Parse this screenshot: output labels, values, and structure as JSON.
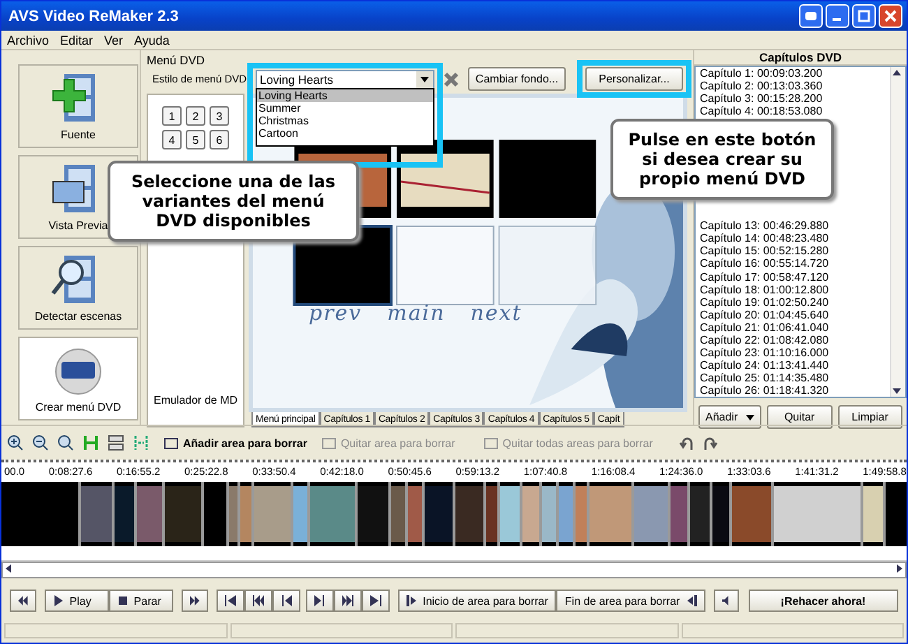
{
  "window": {
    "title": "AVS Video ReMaker 2.3"
  },
  "menu": [
    "Archivo",
    "Editar",
    "Ver",
    "Ayuda"
  ],
  "sidebar": [
    {
      "label": "Fuente",
      "kind": "add",
      "selected": false
    },
    {
      "label": "Vista Previa",
      "kind": "preview",
      "selected": false
    },
    {
      "label": "Detectar escenas",
      "kind": "detect",
      "selected": false
    },
    {
      "label": "Crear menú DVD",
      "kind": "dvd",
      "selected": true
    }
  ],
  "dvd_menu": {
    "group_title": "Menú DVD",
    "style_label": "Estilo de menú DVD:",
    "style_value": "Loving Hearts",
    "style_options": [
      {
        "label": "Loving Hearts",
        "selected": true
      },
      {
        "label": "Summer",
        "selected": false
      },
      {
        "label": "Christmas",
        "selected": false
      },
      {
        "label": "Cartoon",
        "selected": false
      }
    ],
    "buttons": [
      "Cambiar fondo...",
      "Personalizar..."
    ],
    "page_buttons": [
      "1",
      "2",
      "3",
      "4",
      "5",
      "6"
    ],
    "emulator_label": "Emulador de MD",
    "preview_links": [
      "prev",
      "main",
      "next"
    ],
    "tabs": [
      {
        "label": "Menú principal",
        "selected": true
      },
      {
        "label": "Capítulos 1",
        "selected": false
      },
      {
        "label": "Capítulos 2",
        "selected": false
      },
      {
        "label": "Capítulos 3",
        "selected": false
      },
      {
        "label": "Capítulos 4",
        "selected": false
      },
      {
        "label": "Capítulos 5",
        "selected": false
      },
      {
        "label": "Capít",
        "selected": false
      }
    ]
  },
  "chapters": {
    "title": "Capítulos DVD",
    "items": [
      {
        "label": "Capítulo 1:",
        "time": "00:09:03.200"
      },
      {
        "label": "Capítulo 2:",
        "time": "00:13:03.360"
      },
      {
        "label": "Capítulo 3:",
        "time": "00:15:28.200"
      },
      {
        "label": "Capítulo 4:",
        "time": "00:18:53.080"
      },
      {
        "label": "Capítulo 13:",
        "time": "00:46:29.880"
      },
      {
        "label": "Capítulo 14:",
        "time": "00:48:23.480"
      },
      {
        "label": "Capítulo 15:",
        "time": "00:52:15.280"
      },
      {
        "label": "Capítulo 16:",
        "time": "00:55:14.720"
      },
      {
        "label": "Capítulo 17:",
        "time": "00:58:47.120"
      },
      {
        "label": "Capítulo 18:",
        "time": "01:00:12.800"
      },
      {
        "label": "Capítulo 19:",
        "time": "01:02:50.240"
      },
      {
        "label": "Capítulo 20:",
        "time": "01:04:45.640"
      },
      {
        "label": "Capítulo 21:",
        "time": "01:06:41.040"
      },
      {
        "label": "Capítulo 22:",
        "time": "01:08:42.080"
      },
      {
        "label": "Capítulo 23:",
        "time": "01:10:16.000"
      },
      {
        "label": "Capítulo 24:",
        "time": "01:13:41.440"
      },
      {
        "label": "Capítulo 25:",
        "time": "01:14:35.480"
      },
      {
        "label": "Capítulo 26:",
        "time": "01:18:41.320"
      }
    ],
    "buttons": [
      "Añadir",
      "Quitar",
      "Limpiar"
    ]
  },
  "toolbar": [
    {
      "label": "Añadir area para borrar",
      "disabled": false
    },
    {
      "label": "Quitar area para borrar",
      "disabled": true
    },
    {
      "label": "Quitar todas areas para borrar",
      "disabled": true
    }
  ],
  "ruler": [
    "00.0",
    "0:08:27.6",
    "0:16:55.2",
    "0:25:22.8",
    "0:33:50.4",
    "0:42:18.0",
    "0:50:45.6",
    "0:59:13.2",
    "1:07:40.8",
    "1:16:08.4",
    "1:24:36.0",
    "1:33:03.6",
    "1:41:31.2",
    "1:49:58.8"
  ],
  "playback": {
    "play": "Play",
    "stop": "Parar",
    "area_start": "Inicio de area para borrar",
    "area_end": "Fin de area para borrar",
    "run": "¡Rehacer ahora!"
  },
  "callouts": [
    "Seleccione una de las variantes del menú DVD disponibles",
    "Pulse en este botón si desea crear su propio menú DVD"
  ]
}
